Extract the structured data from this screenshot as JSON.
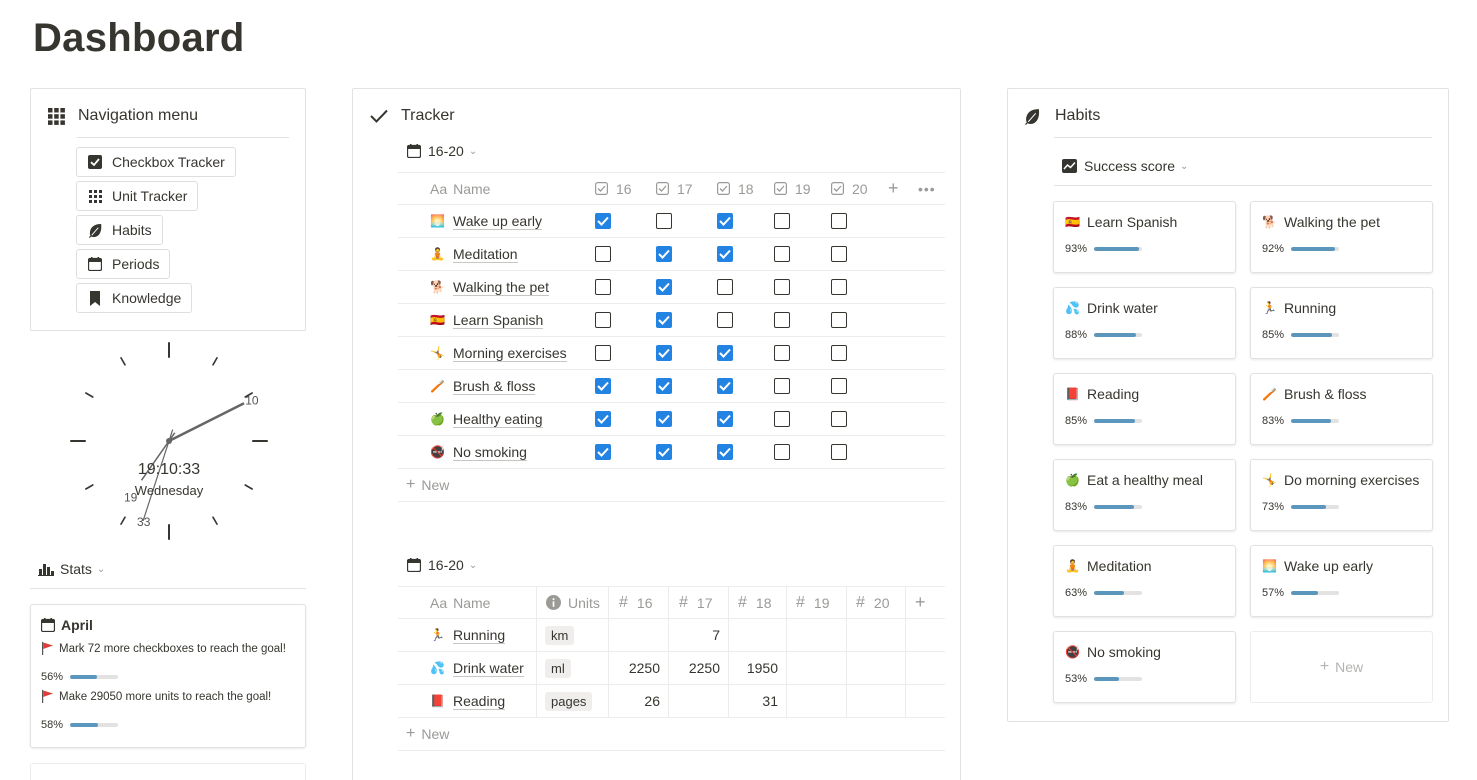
{
  "page": {
    "title": "Dashboard"
  },
  "nav": {
    "title": "Navigation menu",
    "items": [
      {
        "label": "Checkbox Tracker",
        "icon": "checkbox-icon"
      },
      {
        "label": "Unit Tracker",
        "icon": "grid-icon"
      },
      {
        "label": "Habits",
        "icon": "leaf-icon"
      },
      {
        "label": "Periods",
        "icon": "calendar-icon"
      },
      {
        "label": "Knowledge",
        "icon": "bookmark-icon"
      }
    ]
  },
  "clock": {
    "time": "19:10:33",
    "day": "Wednesday",
    "hour_label": "19",
    "minute_label": "10",
    "second_label": "33",
    "hour": 19,
    "minute": 10,
    "second": 33
  },
  "stats": {
    "label": "Stats",
    "card": {
      "month": "April",
      "msg1": "Mark 72 more checkboxes to reach the goal!",
      "pct1": "56%",
      "pct1_value": 0.56,
      "msg2": "Make 29050 more units to reach the goal!",
      "pct2": "58%",
      "pct2_value": 0.58
    }
  },
  "tracker": {
    "title": "Tracker",
    "checkbox_view": {
      "tab": "16-20",
      "name_header": "Name",
      "name_prefix": "Aa",
      "days": [
        "16",
        "17",
        "18",
        "19",
        "20"
      ],
      "rows": [
        {
          "emoji": "🌅",
          "name": "Wake up early",
          "checks": [
            true,
            false,
            true,
            false,
            false
          ]
        },
        {
          "emoji": "🧘",
          "name": "Meditation",
          "checks": [
            false,
            true,
            true,
            false,
            false
          ]
        },
        {
          "emoji": "🐕",
          "name": "Walking the pet",
          "checks": [
            false,
            true,
            false,
            false,
            false
          ]
        },
        {
          "emoji": "🇪🇸",
          "name": "Learn Spanish",
          "checks": [
            false,
            true,
            false,
            false,
            false
          ]
        },
        {
          "emoji": "🤸",
          "name": "Morning exercises",
          "checks": [
            false,
            true,
            true,
            false,
            false
          ]
        },
        {
          "emoji": "🪥",
          "name": "Brush & floss",
          "checks": [
            true,
            true,
            true,
            false,
            false
          ]
        },
        {
          "emoji": "🍏",
          "name": "Healthy eating",
          "checks": [
            true,
            true,
            true,
            false,
            false
          ]
        },
        {
          "emoji": "🚭",
          "name": "No smoking",
          "checks": [
            true,
            true,
            true,
            false,
            false
          ]
        }
      ],
      "new_label": "New"
    },
    "unit_view": {
      "tab": "16-20",
      "name_header": "Name",
      "name_prefix": "Aa",
      "units_header": "Units",
      "days": [
        "16",
        "17",
        "18",
        "19",
        "20"
      ],
      "rows": [
        {
          "emoji": "🏃",
          "name": "Running",
          "unit": "km",
          "values": [
            "",
            "7",
            "",
            "",
            ""
          ]
        },
        {
          "emoji": "💦",
          "name": "Drink water",
          "unit": "ml",
          "values": [
            "2250",
            "2250",
            "1950",
            "",
            ""
          ]
        },
        {
          "emoji": "📕",
          "name": "Reading",
          "unit": "pages",
          "values": [
            "26",
            "",
            "31",
            "",
            ""
          ]
        }
      ],
      "new_label": "New"
    }
  },
  "habits": {
    "title": "Habits",
    "view": "Success score",
    "cards": [
      {
        "emoji": "🇪🇸",
        "name": "Learn Spanish",
        "pct": "93%",
        "value": 0.93
      },
      {
        "emoji": "🐕",
        "name": "Walking the pet",
        "pct": "92%",
        "value": 0.92
      },
      {
        "emoji": "💦",
        "name": "Drink water",
        "pct": "88%",
        "value": 0.88
      },
      {
        "emoji": "🏃",
        "name": "Running",
        "pct": "85%",
        "value": 0.85
      },
      {
        "emoji": "📕",
        "name": "Reading",
        "pct": "85%",
        "value": 0.85
      },
      {
        "emoji": "🪥",
        "name": "Brush & floss",
        "pct": "83%",
        "value": 0.83
      },
      {
        "emoji": "🍏",
        "name": "Eat a healthy meal",
        "pct": "83%",
        "value": 0.83
      },
      {
        "emoji": "🤸",
        "name": "Do morning exercises",
        "pct": "73%",
        "value": 0.73
      },
      {
        "emoji": "🧘",
        "name": "Meditation",
        "pct": "63%",
        "value": 0.63
      },
      {
        "emoji": "🌅",
        "name": "Wake up early",
        "pct": "57%",
        "value": 0.57
      },
      {
        "emoji": "🚭",
        "name": "No smoking",
        "pct": "53%",
        "value": 0.53
      }
    ],
    "new_label": "New"
  },
  "colors": {
    "accent": "#2383e2",
    "bar": "#5b97bd",
    "text": "#37352f",
    "muted": "#9b9a97"
  }
}
